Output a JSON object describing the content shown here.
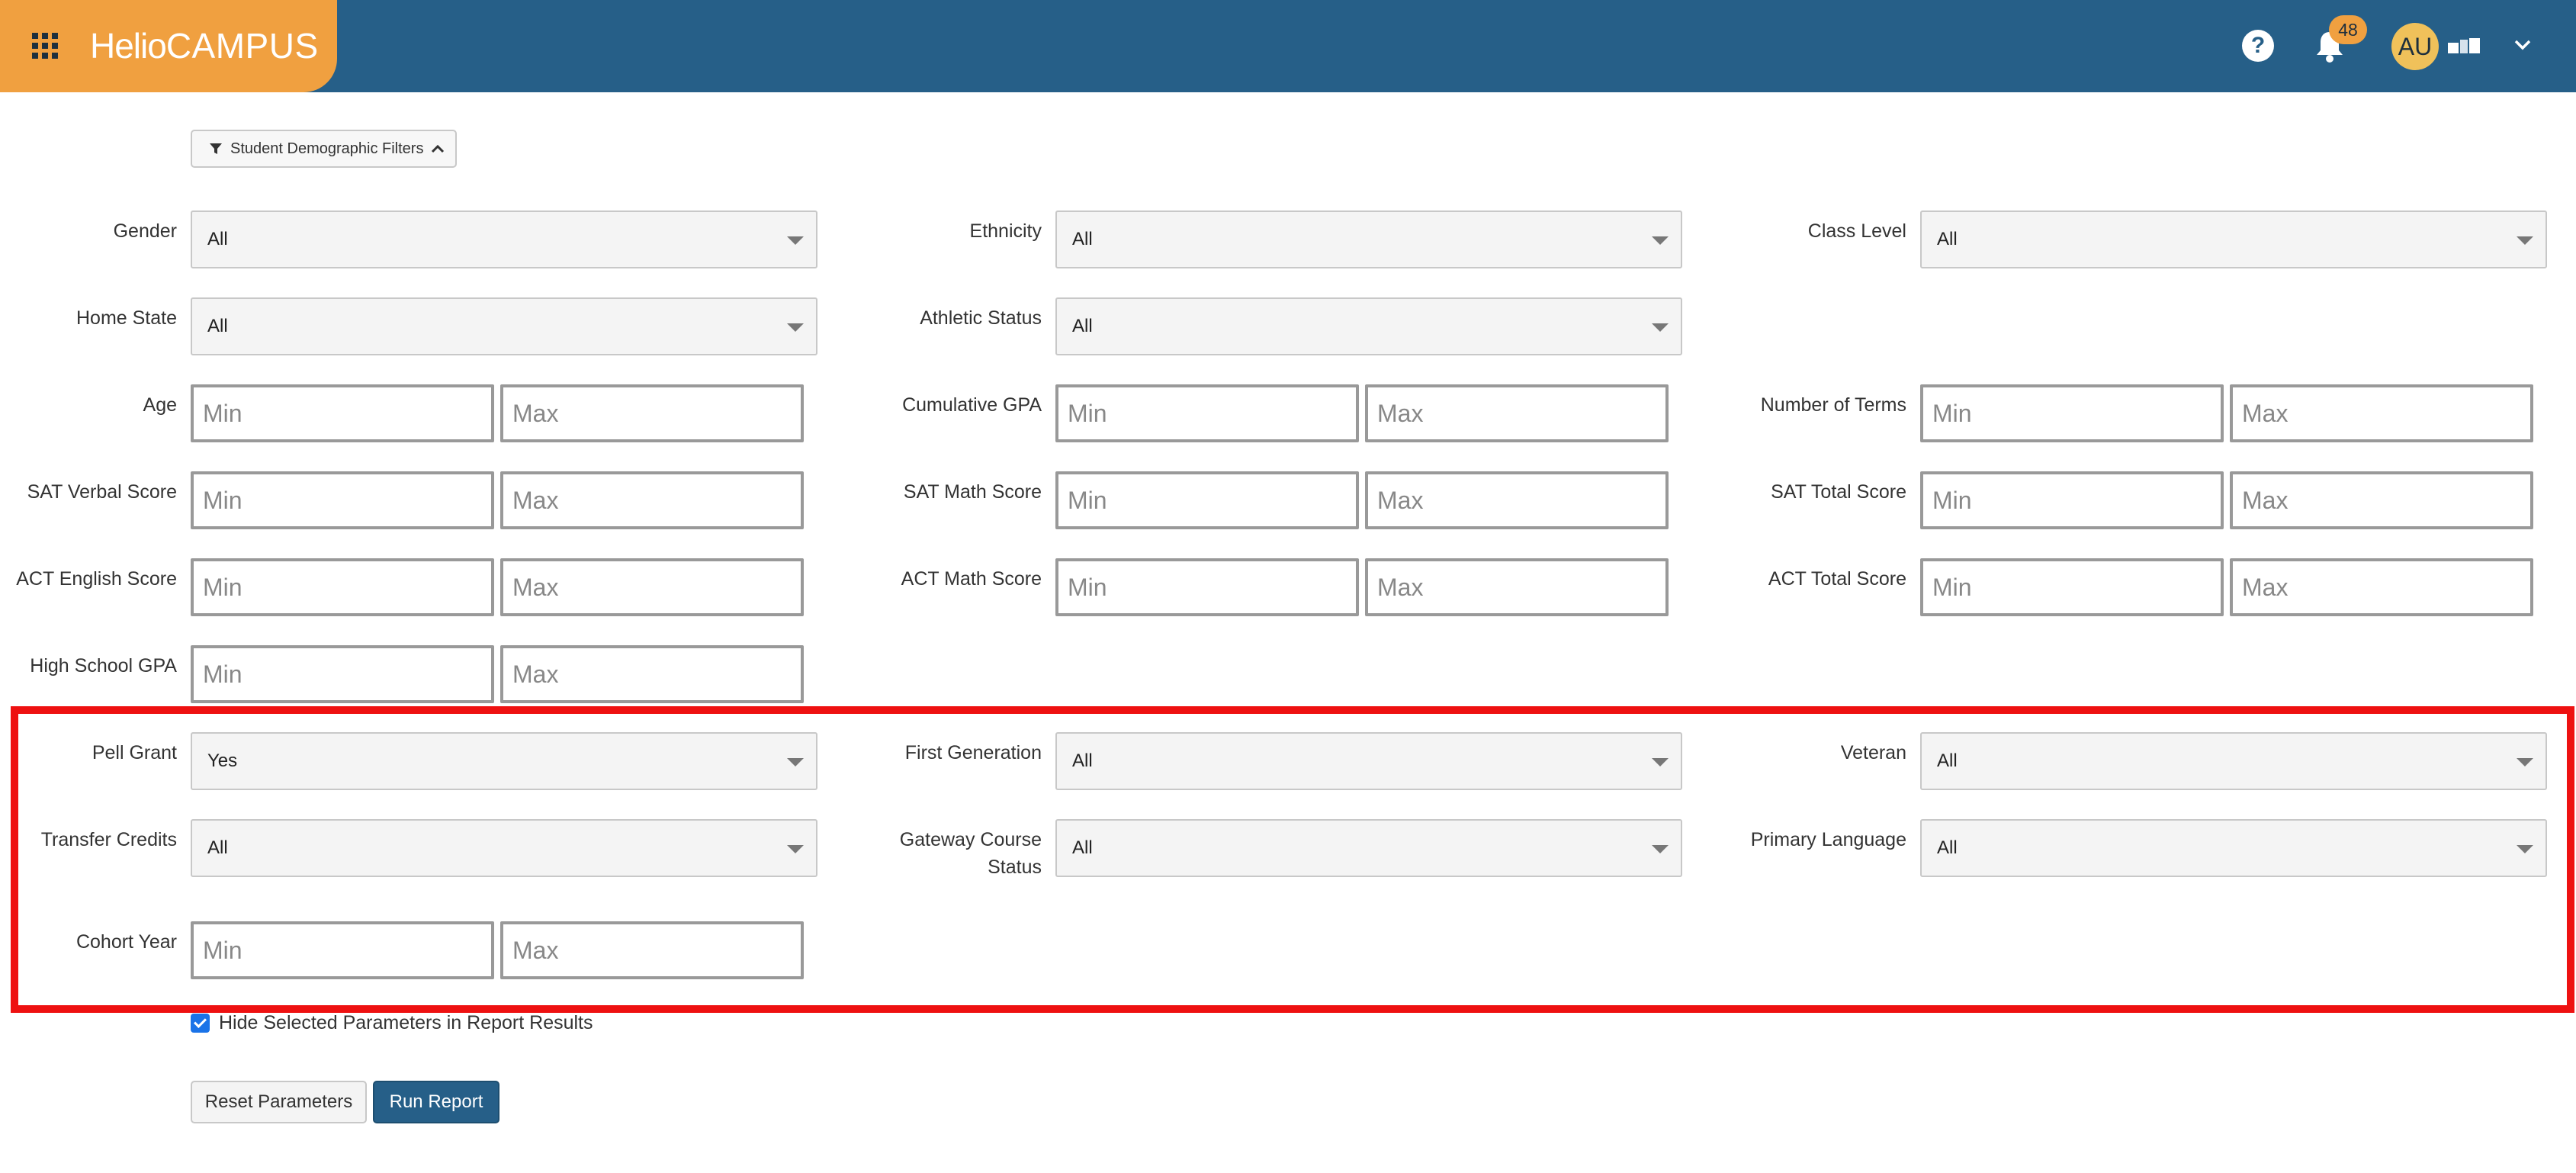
{
  "header": {
    "brand_part1": "Helio",
    "brand_part2": "CAMPUS",
    "help_symbol": "?",
    "notification_count": "48",
    "avatar_initials": "AU",
    "icons": [
      "apps-grid-icon",
      "help-icon",
      "bell-icon",
      "user-menu-icon",
      "chevron-down-icon"
    ],
    "colors": {
      "topbar": "#265f88",
      "brand": "#f0a040",
      "avatar": "#f0c15a"
    }
  },
  "filters_toggle": {
    "label": "Student Demographic Filters",
    "icon": "filter-icon",
    "state_icon": "chevron-up-icon"
  },
  "fields": {
    "gender": {
      "label": "Gender",
      "value": "All"
    },
    "ethnicity": {
      "label": "Ethnicity",
      "value": "All"
    },
    "class_level": {
      "label": "Class Level",
      "value": "All"
    },
    "home_state": {
      "label": "Home State",
      "value": "All"
    },
    "athletic_status": {
      "label": "Athletic Status",
      "value": "All"
    },
    "age": {
      "label": "Age",
      "min": "Min",
      "max": "Max"
    },
    "cumulative_gpa": {
      "label": "Cumulative GPA",
      "min": "Min",
      "max": "Max"
    },
    "number_of_terms": {
      "label": "Number of Terms",
      "min": "Min",
      "max": "Max"
    },
    "sat_verbal": {
      "label": "SAT Verbal Score",
      "min": "Min",
      "max": "Max"
    },
    "sat_math": {
      "label": "SAT Math Score",
      "min": "Min",
      "max": "Max"
    },
    "sat_total": {
      "label": "SAT Total Score",
      "min": "Min",
      "max": "Max"
    },
    "act_english": {
      "label": "ACT English Score",
      "min": "Min",
      "max": "Max"
    },
    "act_math": {
      "label": "ACT Math Score",
      "min": "Min",
      "max": "Max"
    },
    "act_total": {
      "label": "ACT Total Score",
      "min": "Min",
      "max": "Max"
    },
    "hs_gpa": {
      "label": "High School GPA",
      "min": "Min",
      "max": "Max"
    },
    "pell_grant": {
      "label": "Pell Grant",
      "value": "Yes"
    },
    "first_generation": {
      "label": "First Generation",
      "value": "All"
    },
    "veteran": {
      "label": "Veteran",
      "value": "All"
    },
    "transfer_credits": {
      "label": "Transfer Credits",
      "value": "All"
    },
    "gateway_course_status": {
      "label_line1": "Gateway Course",
      "label_line2": "Status",
      "value": "All"
    },
    "primary_language": {
      "label": "Primary Language",
      "value": "All"
    },
    "cohort_year": {
      "label": "Cohort Year",
      "min": "Min",
      "max": "Max"
    }
  },
  "highlight_color": "#ee1111",
  "hide_params": {
    "label": "Hide Selected Parameters in Report Results",
    "checked": true
  },
  "buttons": {
    "reset": "Reset Parameters",
    "run": "Run Report"
  }
}
